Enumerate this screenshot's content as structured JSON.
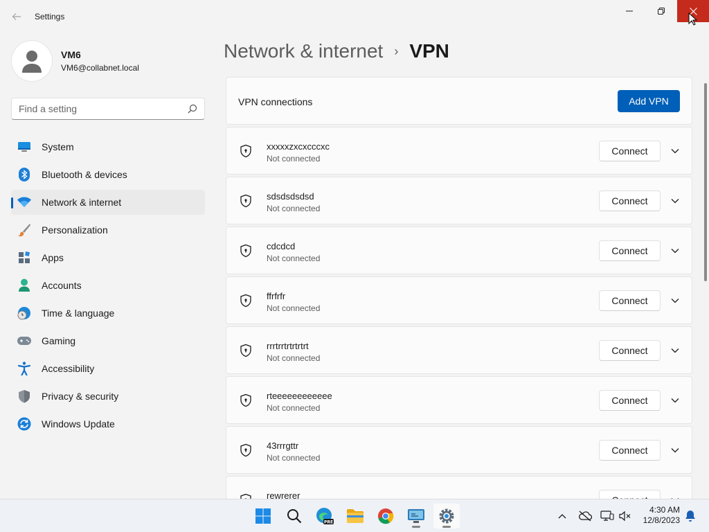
{
  "window": {
    "title": "Settings",
    "back_icon": "back-arrow-icon",
    "minimize_icon": "minimize-icon",
    "maximize_icon": "restore-icon",
    "close_icon": "close-icon",
    "close_color": "#c42b1c"
  },
  "profile": {
    "name": "VM6",
    "email": "VM6@collabnet.local"
  },
  "search": {
    "placeholder": "Find a setting",
    "icon": "search-icon"
  },
  "nav": {
    "items": [
      {
        "label": "System",
        "icon": "system-display-icon",
        "active": false
      },
      {
        "label": "Bluetooth & devices",
        "icon": "bluetooth-icon",
        "active": false
      },
      {
        "label": "Network & internet",
        "icon": "wifi-icon",
        "active": true
      },
      {
        "label": "Personalization",
        "icon": "paintbrush-icon",
        "active": false
      },
      {
        "label": "Apps",
        "icon": "apps-icon",
        "active": false
      },
      {
        "label": "Accounts",
        "icon": "accounts-icon",
        "active": false
      },
      {
        "label": "Time & language",
        "icon": "globe-clock-icon",
        "active": false
      },
      {
        "label": "Gaming",
        "icon": "gamepad-icon",
        "active": false
      },
      {
        "label": "Accessibility",
        "icon": "accessibility-icon",
        "active": false
      },
      {
        "label": "Privacy & security",
        "icon": "shield-icon",
        "active": false
      },
      {
        "label": "Windows Update",
        "icon": "update-icon",
        "active": false
      }
    ],
    "accent": "#005fb8"
  },
  "breadcrumb": {
    "parent": "Network & internet",
    "separator": "›",
    "current": "VPN"
  },
  "vpn_header": {
    "label": "VPN connections",
    "add_button": "Add VPN"
  },
  "vpn_connections": [
    {
      "name": "xxxxxzxcxcccxc",
      "status": "Not connected",
      "action": "Connect"
    },
    {
      "name": "sdsdsdsdsd",
      "status": "Not connected",
      "action": "Connect"
    },
    {
      "name": "cdcdcd",
      "status": "Not connected",
      "action": "Connect"
    },
    {
      "name": "ffrfrfr",
      "status": "Not connected",
      "action": "Connect"
    },
    {
      "name": "rrrtrrtrtrtrtrt",
      "status": "Not connected",
      "action": "Connect"
    },
    {
      "name": "rteeeeeeeeeeee",
      "status": "Not connected",
      "action": "Connect"
    },
    {
      "name": "43rrrgttr",
      "status": "Not connected",
      "action": "Connect"
    },
    {
      "name": "rewrerer",
      "status": "",
      "action": "Connect"
    }
  ],
  "taskbar": {
    "apps": [
      {
        "name": "start",
        "icon": "windows-start-icon"
      },
      {
        "name": "search",
        "icon": "search-icon"
      },
      {
        "name": "edge-preview",
        "icon": "edge-pre-icon"
      },
      {
        "name": "file-explorer",
        "icon": "folder-icon"
      },
      {
        "name": "chrome",
        "icon": "chrome-icon"
      },
      {
        "name": "remote-desktop",
        "icon": "monitor-icon"
      },
      {
        "name": "settings",
        "icon": "gear-icon"
      }
    ],
    "tray": {
      "chevron_icon": "chevron-up-icon",
      "cloud_icon": "cloud-off-icon",
      "network_icon": "network-icon",
      "volume_icon": "volume-muted-icon",
      "notification_icon": "bell-icon"
    },
    "time": "4:30 AM",
    "date": "12/8/2023"
  }
}
